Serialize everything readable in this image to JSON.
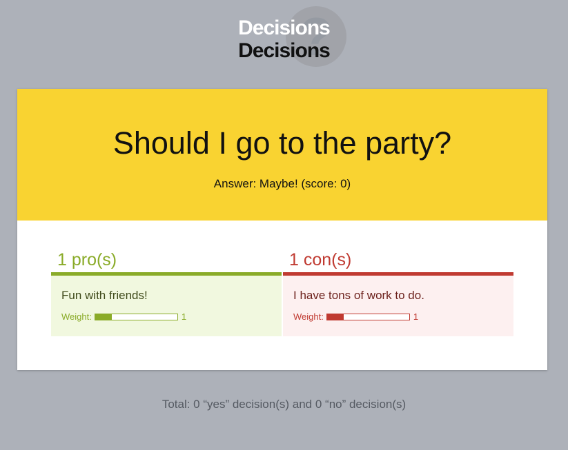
{
  "logo": {
    "line1": "Decisions",
    "line2": "Decisions",
    "mark": "?"
  },
  "question": {
    "title": "Should I go to the party?",
    "answer": "Answer: Maybe! (score: 0)"
  },
  "pros": {
    "heading": "1 pro(s)",
    "color": "#8aab28",
    "items": [
      {
        "text": "Fun with friends!",
        "weight_label": "Weight:",
        "weight_value": "1",
        "weight_fraction": 0.2
      }
    ]
  },
  "cons": {
    "heading": "1 con(s)",
    "color": "#c03a31",
    "items": [
      {
        "text": "I have tons of work to do.",
        "weight_label": "Weight:",
        "weight_value": "1",
        "weight_fraction": 0.2
      }
    ]
  },
  "footer": {
    "total": "Total: 0 “yes” decision(s) and 0 “no” decision(s)"
  },
  "colors": {
    "background": "#adb1b9",
    "header": "#f9d331"
  }
}
